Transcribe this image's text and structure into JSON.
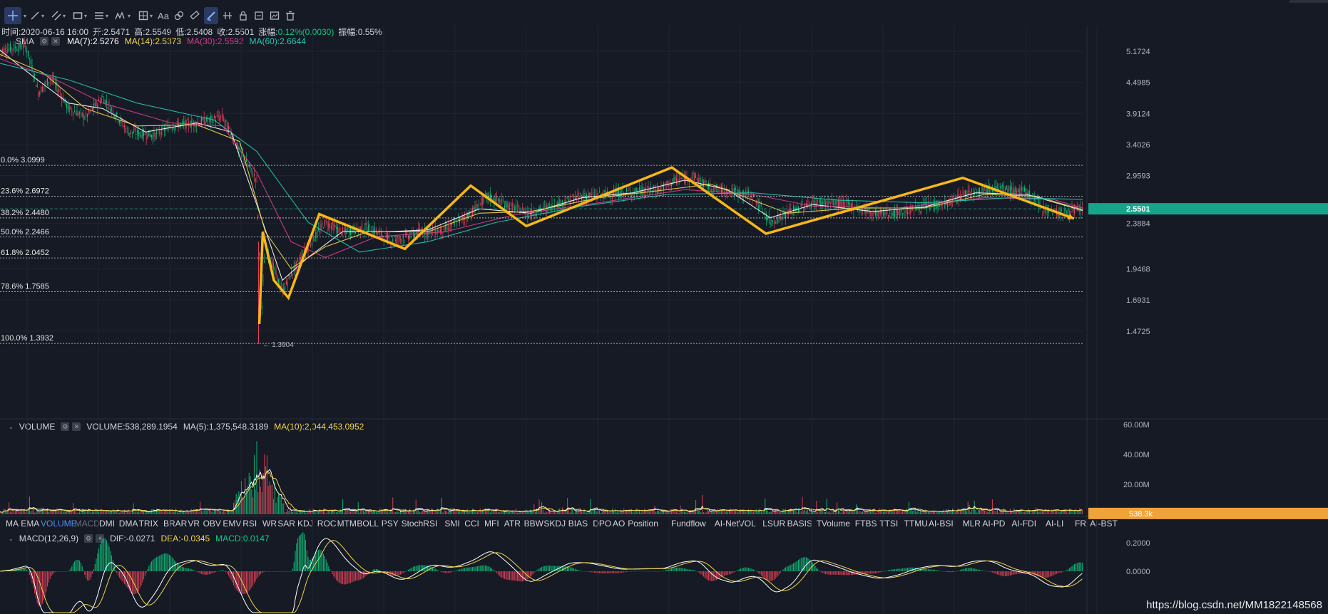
{
  "colors": {
    "background": "#161a25",
    "up": "#0ecb81",
    "down": "#f6465d",
    "ma7": "#ffffff",
    "ma14": "#f0d64a",
    "ma30": "#d63e8c",
    "ma60": "#26c6b0",
    "zigzag": "#f7b815",
    "price_tag": "#16a58b",
    "vol_tag": "#f0a33a"
  },
  "toolbar": {
    "icons": [
      "crosshair-icon",
      "trend-line-icon",
      "parallel-channel-icon",
      "rectangle-icon",
      "fibonacci-icon",
      "wave-pattern-icon",
      "measure-icon",
      "text-icon",
      "pattern-icon",
      "ruler-icon",
      "draw-mode-icon",
      "magnet-icon",
      "lock-icon",
      "hide-drawings-icon",
      "screenshot-icon",
      "delete-icon"
    ],
    "text_label": "Aa"
  },
  "ohlc": {
    "time": "时间:2020-06-16 16:00",
    "open": "开:2.5471",
    "high": "高:2.5549",
    "low": "低:2.5408",
    "close": "收:2.5501",
    "change_label": "涨幅:",
    "change_value": "0.12%(0.0030)",
    "amplitude": "振幅:0.55%"
  },
  "price_indicator": {
    "name": "SMA",
    "ma7": "MA(7):2.5276",
    "ma14": "MA(14):2.5373",
    "ma30": "MA(30):2.5592",
    "ma60": "MA(60):2.6644"
  },
  "volume_indicator": {
    "name": "VOLUME",
    "value": "VOLUME:538,289.1954",
    "ma5": "MA(5):1,375,548.3189",
    "ma10": "MA(10):2,044,453.0952"
  },
  "macd_indicator": {
    "name": "MACD(12,26,9)",
    "dif": "DIF:-0.0271",
    "dea": "DEA:-0.0345",
    "macd": "MACD:0.0147"
  },
  "indicator_tabs": [
    "MA",
    "EMA",
    "VOLUME",
    "MACD",
    "DMI",
    "DMA",
    "TRIX",
    "BRAR",
    "VR",
    "OBV",
    "EMV",
    "RSI",
    "WR",
    "SAR",
    "KDJ",
    "ROC",
    "MTM",
    "BOLL",
    "PSY",
    "StochRSI",
    "SMI",
    "CCI",
    "MFI",
    "ATR",
    "BBW",
    "SKDJ",
    "BIAS",
    "DPO",
    "AO",
    "Position",
    "Fundflow",
    "AI-NetVOL",
    "LSUR",
    "BASIS",
    "TVolume",
    "FTBS",
    "TTSI",
    "TTMU",
    "AI-BSI",
    "MLR",
    "AI-PD",
    "AI-FDI",
    "AI-LI",
    "FR",
    "AI-BST"
  ],
  "active_tabs": [
    "VOLUME",
    "MACD"
  ],
  "price_axis_labels": [
    "5.1724",
    "4.4985",
    "3.9124",
    "3.4026",
    "2.9593",
    "2.5501",
    "2.3884",
    "1.9468",
    "1.6931",
    "1.4725"
  ],
  "volume_axis_labels": [
    "60.00M",
    "40.00M",
    "20.00M",
    "538.3k"
  ],
  "macd_axis_labels": [
    "0.2000",
    "0.0000"
  ],
  "current_price": "2.5501",
  "current_volume": "538.3k",
  "low_marker": "1.3904",
  "watermark": "https://blog.csdn.net/MM1822148568",
  "chart_data": {
    "type": "candlestick",
    "price_scale": "log",
    "price_range": [
      1.35,
      5.55
    ],
    "fib_levels": [
      {
        "label": "0.0% 3.0999",
        "value": 3.0999
      },
      {
        "label": "23.6% 2.6972",
        "value": 2.6972
      },
      {
        "label": "38.2% 2.4480",
        "value": 2.448
      },
      {
        "label": "50.0% 2.2466",
        "value": 2.2466
      },
      {
        "label": "61.8% 2.0452",
        "value": 2.0452
      },
      {
        "label": "78.6% 1.7585",
        "value": 1.7585
      },
      {
        "label": "100.0% 1.3932",
        "value": 1.3932
      }
    ],
    "price_path": [
      [
        0,
        5.2
      ],
      [
        30,
        5.3
      ],
      [
        45,
        4.3
      ],
      [
        60,
        4.6
      ],
      [
        80,
        4.0
      ],
      [
        100,
        3.85
      ],
      [
        120,
        4.2
      ],
      [
        150,
        3.6
      ],
      [
        180,
        3.55
      ],
      [
        200,
        3.7
      ],
      [
        230,
        3.75
      ],
      [
        260,
        3.85
      ],
      [
        280,
        3.3
      ],
      [
        300,
        2.9
      ],
      [
        305,
        1.5
      ],
      [
        310,
        2.15
      ],
      [
        330,
        1.75
      ],
      [
        340,
        1.9
      ],
      [
        360,
        2.15
      ],
      [
        380,
        2.4
      ],
      [
        400,
        2.3
      ],
      [
        430,
        2.35
      ],
      [
        460,
        2.2
      ],
      [
        490,
        2.3
      ],
      [
        520,
        2.32
      ],
      [
        550,
        2.5
      ],
      [
        570,
        2.7
      ],
      [
        590,
        2.6
      ],
      [
        620,
        2.5
      ],
      [
        650,
        2.6
      ],
      [
        680,
        2.7
      ],
      [
        710,
        2.72
      ],
      [
        740,
        2.75
      ],
      [
        770,
        2.78
      ],
      [
        790,
        2.9
      ],
      [
        810,
        2.95
      ],
      [
        830,
        2.8
      ],
      [
        860,
        2.75
      ],
      [
        880,
        2.7
      ],
      [
        900,
        2.4
      ],
      [
        920,
        2.5
      ],
      [
        950,
        2.62
      ],
      [
        970,
        2.62
      ],
      [
        990,
        2.6
      ],
      [
        1020,
        2.5
      ],
      [
        1050,
        2.5
      ],
      [
        1080,
        2.58
      ],
      [
        1110,
        2.62
      ],
      [
        1130,
        2.75
      ],
      [
        1160,
        2.8
      ],
      [
        1200,
        2.75
      ],
      [
        1220,
        2.55
      ],
      [
        1240,
        2.5
      ],
      [
        1265,
        2.55
      ]
    ],
    "ma_series": [
      {
        "name": "MA(7)",
        "color": "#ffffff",
        "points": [
          [
            0,
            5.2
          ],
          [
            40,
            4.6
          ],
          [
            80,
            4.1
          ],
          [
            120,
            4.0
          ],
          [
            170,
            3.6
          ],
          [
            230,
            3.75
          ],
          [
            270,
            3.6
          ],
          [
            300,
            2.6
          ],
          [
            330,
            1.85
          ],
          [
            360,
            2.05
          ],
          [
            400,
            2.3
          ],
          [
            450,
            2.3
          ],
          [
            500,
            2.32
          ],
          [
            560,
            2.55
          ],
          [
            620,
            2.5
          ],
          [
            680,
            2.68
          ],
          [
            740,
            2.74
          ],
          [
            800,
            2.9
          ],
          [
            850,
            2.78
          ],
          [
            900,
            2.45
          ],
          [
            950,
            2.6
          ],
          [
            1020,
            2.52
          ],
          [
            1080,
            2.57
          ],
          [
            1140,
            2.74
          ],
          [
            1200,
            2.72
          ],
          [
            1265,
            2.53
          ]
        ]
      },
      {
        "name": "MA(14)",
        "color": "#f0d64a",
        "points": [
          [
            0,
            5.1
          ],
          [
            50,
            4.7
          ],
          [
            100,
            4.0
          ],
          [
            160,
            3.7
          ],
          [
            230,
            3.72
          ],
          [
            280,
            3.45
          ],
          [
            310,
            2.3
          ],
          [
            340,
            1.95
          ],
          [
            380,
            2.15
          ],
          [
            430,
            2.3
          ],
          [
            500,
            2.3
          ],
          [
            560,
            2.5
          ],
          [
            620,
            2.52
          ],
          [
            700,
            2.68
          ],
          [
            780,
            2.78
          ],
          [
            830,
            2.85
          ],
          [
            880,
            2.65
          ],
          [
            920,
            2.5
          ],
          [
            1000,
            2.56
          ],
          [
            1080,
            2.56
          ],
          [
            1150,
            2.72
          ],
          [
            1210,
            2.7
          ],
          [
            1265,
            2.54
          ]
        ]
      },
      {
        "name": "MA(30)",
        "color": "#d63e8c",
        "points": [
          [
            0,
            5.0
          ],
          [
            60,
            4.6
          ],
          [
            120,
            4.1
          ],
          [
            200,
            3.75
          ],
          [
            260,
            3.7
          ],
          [
            300,
            3.0
          ],
          [
            340,
            2.2
          ],
          [
            380,
            2.05
          ],
          [
            440,
            2.25
          ],
          [
            520,
            2.3
          ],
          [
            600,
            2.48
          ],
          [
            700,
            2.62
          ],
          [
            800,
            2.78
          ],
          [
            880,
            2.72
          ],
          [
            950,
            2.58
          ],
          [
            1050,
            2.56
          ],
          [
            1150,
            2.68
          ],
          [
            1230,
            2.66
          ],
          [
            1265,
            2.56
          ]
        ]
      },
      {
        "name": "MA(60)",
        "color": "#26c6b0",
        "points": [
          [
            0,
            4.9
          ],
          [
            80,
            4.55
          ],
          [
            160,
            4.1
          ],
          [
            250,
            3.8
          ],
          [
            300,
            3.3
          ],
          [
            360,
            2.4
          ],
          [
            420,
            2.1
          ],
          [
            500,
            2.2
          ],
          [
            580,
            2.4
          ],
          [
            680,
            2.58
          ],
          [
            780,
            2.72
          ],
          [
            880,
            2.74
          ],
          [
            980,
            2.65
          ],
          [
            1080,
            2.62
          ],
          [
            1180,
            2.68
          ],
          [
            1265,
            2.66
          ]
        ]
      }
    ],
    "zigzag": [
      [
        303,
        1.52
      ],
      [
        307,
        2.3
      ],
      [
        320,
        1.85
      ],
      [
        337,
        1.71
      ],
      [
        373,
        2.49
      ],
      [
        473,
        2.13
      ],
      [
        550,
        2.83
      ],
      [
        615,
        2.36
      ],
      [
        785,
        3.07
      ],
      [
        895,
        2.28
      ],
      [
        1125,
        2.93
      ],
      [
        1255,
        2.44
      ]
    ],
    "volume_series": {
      "max": 60,
      "unit": "M",
      "ma5_color": "#ffffff",
      "ma10_color": "#f0d64a",
      "peak_index": 302
    },
    "macd_series": {
      "range": [
        -0.3,
        0.3
      ],
      "dif_color": "#ffffff",
      "dea_color": "#f0d64a"
    }
  }
}
